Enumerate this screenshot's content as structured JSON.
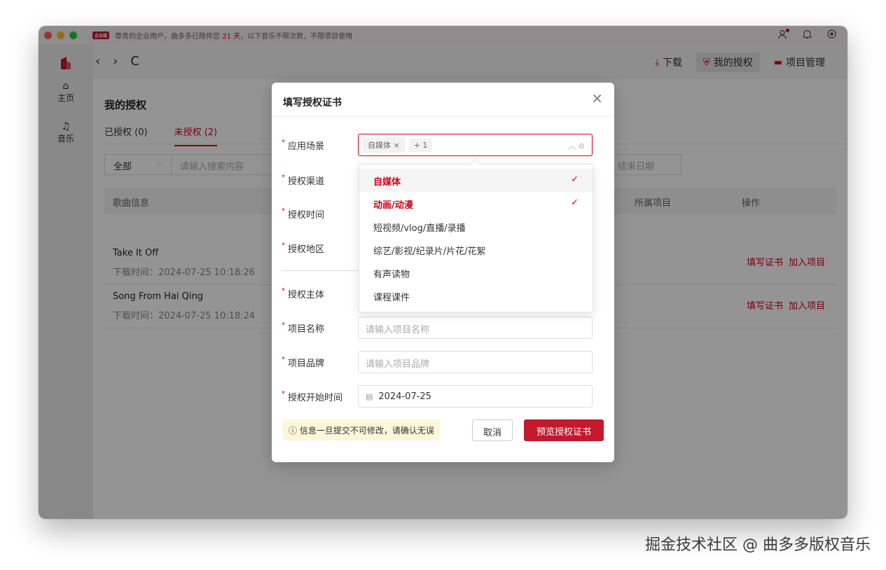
{
  "titlebar": {
    "vip_badge": "企业版",
    "notice_prefix": "尊贵的企业用户，曲多多已陪伴您 ",
    "notice_days": "21 天",
    "notice_suffix": "，以下音乐不限次数，不限项目使用"
  },
  "topnav": {
    "back": "‹",
    "forward": "›",
    "refresh": "C",
    "download_label": "下载",
    "my_license_label": "我的授权",
    "project_mgmt_label": "项目管理"
  },
  "rail": {
    "items": [
      {
        "label": "主页"
      },
      {
        "label": "音乐"
      }
    ]
  },
  "page": {
    "title": "我的授权",
    "tabs": [
      {
        "label": "已授权 (0)"
      },
      {
        "label": "未授权 (2)"
      }
    ],
    "filter_select": "全部",
    "search_placeholder": "请输入搜索内容",
    "end_date_placeholder": "结束日期",
    "columns": [
      "歌曲信息",
      "所属项目",
      "操作"
    ],
    "rows": [
      {
        "title": "Take It Off",
        "meta": "下载时间：2024-07-25 10:18:26",
        "op_fill": "填写证书",
        "op_add": "加入项目"
      },
      {
        "title": "Song From Hai Qing",
        "meta": "下载时间：2024-07-25 10:18:24",
        "op_fill": "填写证书",
        "op_add": "加入项目"
      }
    ]
  },
  "modal": {
    "title": "填写授权证书",
    "close": "×",
    "fields": {
      "scene": "应用场景",
      "channel": "授权渠道",
      "time": "授权时间",
      "region": "授权地区",
      "subject": "授权主体",
      "project_name": "项目名称",
      "project_brand": "项目品牌",
      "start_time": "授权开始时间"
    },
    "scene_chip": "自媒体",
    "scene_more": "+ 1",
    "project_name_placeholder": "请输入项目名称",
    "project_brand_placeholder": "请输入项目品牌",
    "start_date": "2024-07-25",
    "warning": "ⓘ 信息一旦提交不可修改，请确认无误",
    "cancel": "取消",
    "submit": "预览授权证书"
  },
  "dropdown": {
    "options": [
      {
        "label": "自媒体",
        "selected": true
      },
      {
        "label": "动画/动漫",
        "selected": true
      },
      {
        "label": "短视频/vlog/直播/录播",
        "selected": false
      },
      {
        "label": "综艺/影视/纪录片/片花/花絮",
        "selected": false
      },
      {
        "label": "有声读物",
        "selected": false
      },
      {
        "label": "课程课件",
        "selected": false
      }
    ]
  },
  "watermark": "掘金技术社区 @ 曲多多版权音乐",
  "colors": {
    "accent": "#c4182b",
    "accent_text": "#d0021b"
  }
}
